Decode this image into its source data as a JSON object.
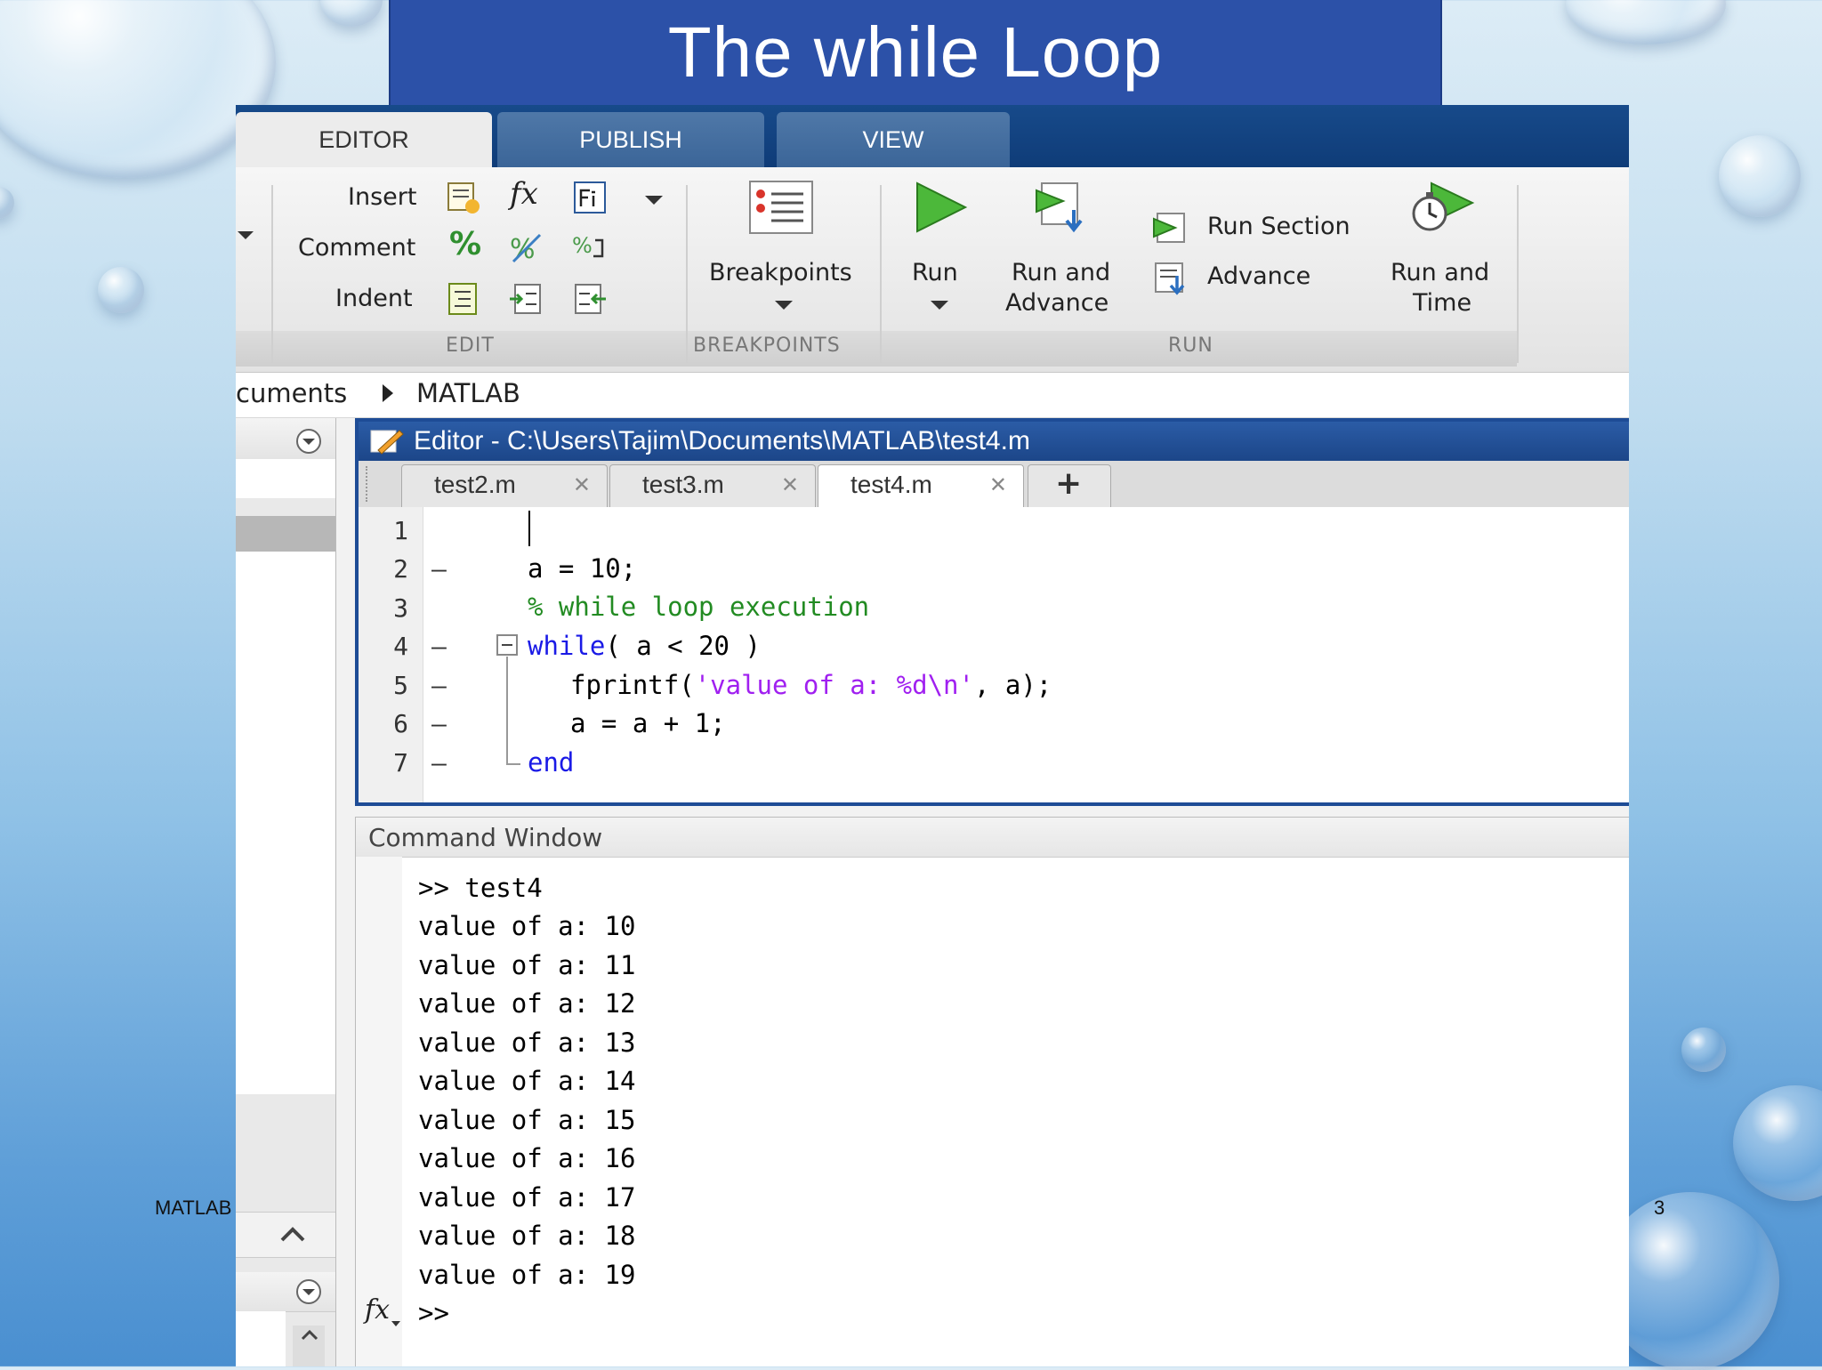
{
  "slide": {
    "title": "The while Loop",
    "footer_left": "MATLAB",
    "page_number": "3"
  },
  "ribbon": {
    "tabs": [
      "EDITOR",
      "PUBLISH",
      "VIEW"
    ],
    "edit": {
      "insert": "Insert",
      "comment": "Comment",
      "indent": "Indent",
      "label": "EDIT"
    },
    "breakpoints": {
      "button": "Breakpoints",
      "label": "BREAKPOINTS"
    },
    "run": {
      "run": "Run",
      "run_and_advance_1": "Run and",
      "run_and_advance_2": "Advance",
      "run_section": "Run Section",
      "advance": "Advance",
      "run_and_time_1": "Run and",
      "run_and_time_2": "Time",
      "label": "RUN"
    }
  },
  "address": {
    "parent": "cuments",
    "current": "MATLAB"
  },
  "editor": {
    "title": "Editor - C:\\Users\\Tajim\\Documents\\MATLAB\\test4.m",
    "tabs": [
      "test2.m",
      "test3.m",
      "test4.m"
    ],
    "active_tab": "test4.m",
    "add_tab": "+",
    "line_numbers": [
      "1",
      "2",
      "3",
      "4",
      "5",
      "6",
      "7"
    ],
    "breakpoint_marks": [
      "",
      "—",
      "",
      "—",
      "—",
      "—",
      "—"
    ],
    "line2": "a = 10;",
    "line3": "% while loop execution",
    "line4_kw": "while",
    "line4_rest": "( a < 20 )",
    "line5_start": "fprintf(",
    "line5_str": "'value of a: %d\\n'",
    "line5_end": ", a);",
    "line6": "a = a + 1;",
    "line7_kw": "end"
  },
  "command_window": {
    "title": "Command Window",
    "command": ">> test4",
    "output": [
      "value of a: 10",
      "value of a: 11",
      "value of a: 12",
      "value of a: 13",
      "value of a: 14",
      "value of a: 15",
      "value of a: 16",
      "value of a: 17",
      "value of a: 18",
      "value of a: 19"
    ],
    "prompt": ">>",
    "fx_symbol": "fx"
  }
}
